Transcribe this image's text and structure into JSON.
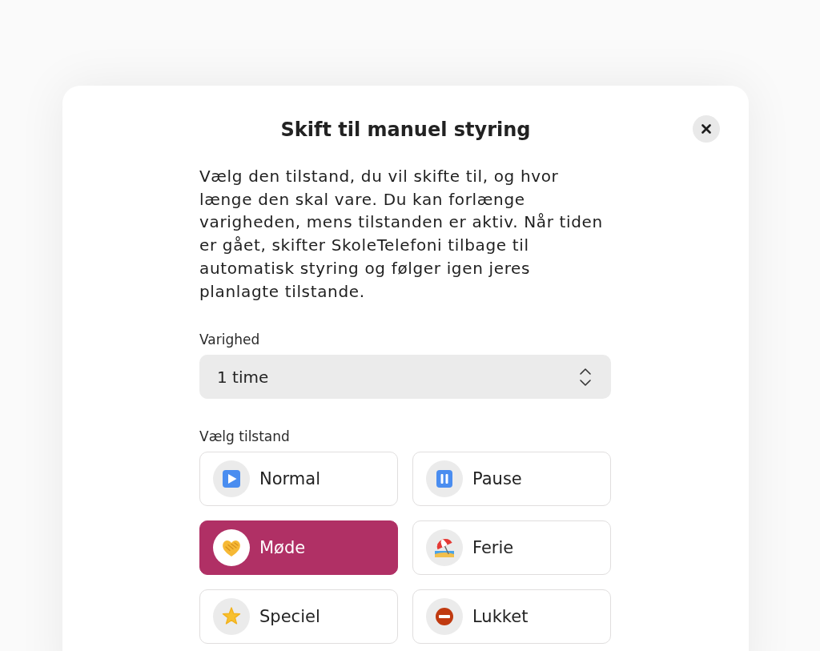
{
  "dialog": {
    "title": "Skift til manuel styring",
    "description": "Vælg den tilstand, du vil skifte til, og hvor længe den skal vare. Du kan forlænge varigheden, mens tilstanden er aktiv. Når tiden er gået, skifter SkoleTelefoni tilbage til automatisk styring og følger igen jeres planlagte tilstande.",
    "duration": {
      "label": "Varighed",
      "value": "1 time"
    },
    "mode_label": "Vælg tilstand",
    "modes": [
      {
        "label": "Normal",
        "kind": "play",
        "selected": false
      },
      {
        "label": "Pause",
        "kind": "pause",
        "selected": false
      },
      {
        "label": "Møde",
        "kind": "handshake",
        "selected": true
      },
      {
        "label": "Ferie",
        "kind": "beach",
        "selected": false
      },
      {
        "label": "Speciel",
        "kind": "star",
        "selected": false
      },
      {
        "label": "Lukket",
        "kind": "noentry",
        "selected": false
      }
    ]
  }
}
